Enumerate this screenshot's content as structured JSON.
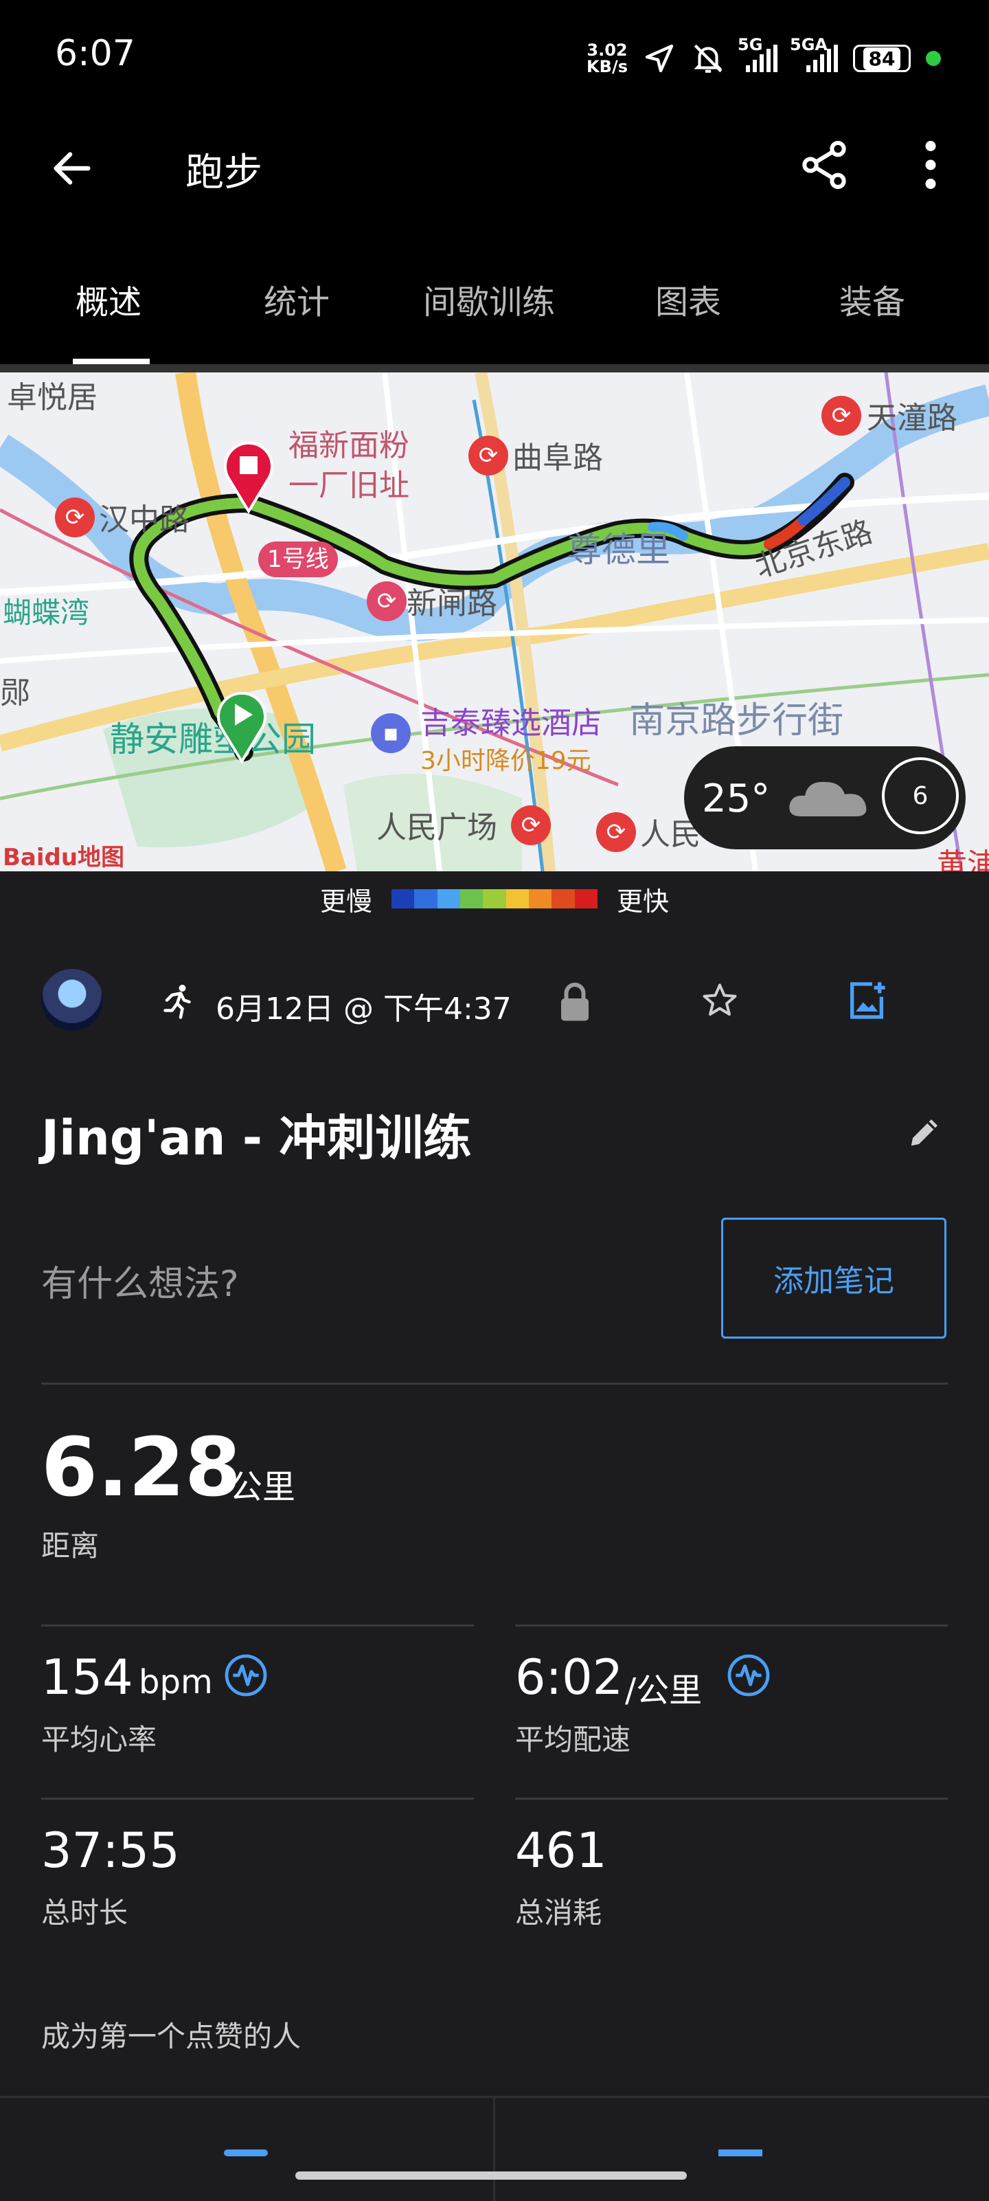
{
  "status_bar": {
    "time": "6:07",
    "net_speed_value": "3.02",
    "net_speed_unit": "KB/s",
    "signal1_label": "5G",
    "signal2_label": "5GA",
    "battery": "84"
  },
  "app_bar": {
    "title": "跑步",
    "icons": [
      "back-arrow-icon",
      "share-icon",
      "more-vert-icon"
    ]
  },
  "tabs": [
    {
      "label": "概述",
      "active": true
    },
    {
      "label": "统计",
      "active": false
    },
    {
      "label": "间歇训练",
      "active": false
    },
    {
      "label": "图表",
      "active": false
    },
    {
      "label": "装备",
      "active": false
    }
  ],
  "map": {
    "labels": {
      "zhuoyueju": "卓悦居",
      "fuxin": "福新面粉",
      "fuxin2": "一厂旧址",
      "qufu": "曲阜路",
      "tiantong": "天潼路",
      "hanzhong": "汉中路",
      "zunde": "尊德里",
      "beijing": "北京东路",
      "hudie": "蝴蝶湾",
      "xinzha": "新闸路",
      "jingan": "静安雕塑公园",
      "hotel": "吉泰臻选酒店",
      "hotel_promo": "3小时降价19元",
      "nanjing": "南京路步行街",
      "renmin": "人民广场",
      "renmin2": "人民",
      "huangpu": "黄浦",
      "edge_left": "郧",
      "line1": "1号线",
      "baidu": "Baidu地图"
    },
    "weather": {
      "temp": "25°",
      "badge": "6"
    }
  },
  "legend": {
    "slower": "更慢",
    "faster": "更快",
    "colors": [
      "#1a3fb8",
      "#2f6fe0",
      "#4aa3f0",
      "#6cc24a",
      "#9ccc3a",
      "#f2c233",
      "#f08a24",
      "#e04a1f",
      "#d81e1e"
    ]
  },
  "activity": {
    "date": "6月12日 @ 下午4:37",
    "title": "Jing'an - 冲刺训练",
    "thoughts_placeholder": "有什么想法?",
    "add_note": "添加笔记"
  },
  "stats": {
    "distance": {
      "value": "6.28",
      "unit": "公里",
      "label": "距离"
    },
    "heart_rate": {
      "value": "154",
      "unit": "bpm",
      "label": "平均心率"
    },
    "pace": {
      "value": "6:02",
      "unit": "/公里",
      "label": "平均配速"
    },
    "duration": {
      "value": "37:55",
      "label": "总时长"
    },
    "calories": {
      "value": "461",
      "label": "总消耗"
    }
  },
  "kudos_text": "成为第一个点赞的人",
  "accent": "#4a9ff5"
}
